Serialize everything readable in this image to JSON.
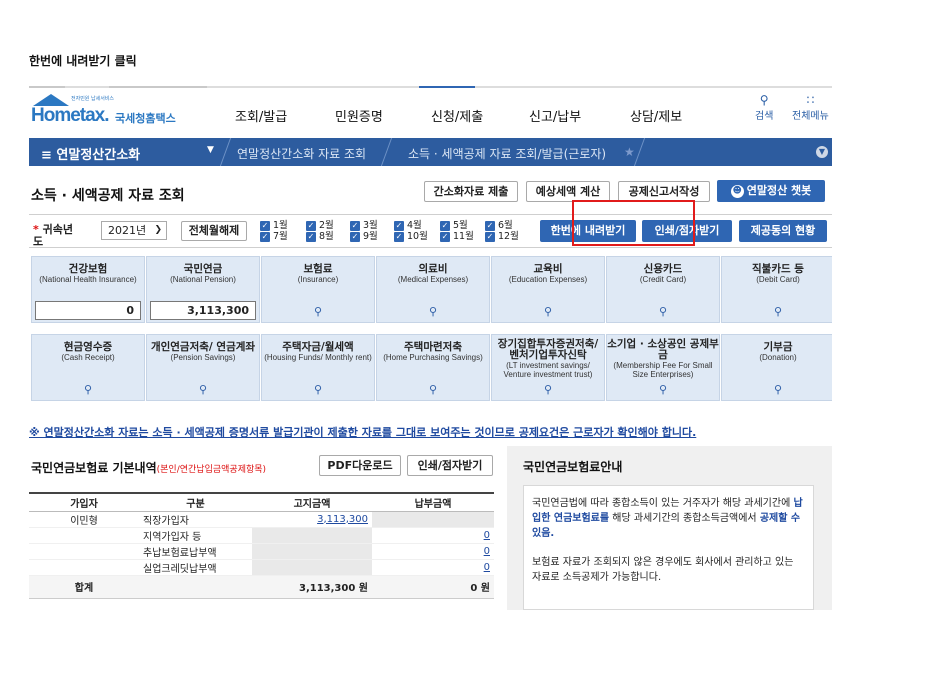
{
  "caption": "한번에 내려받기 클릭",
  "header": {
    "logo_small": "전자민원 납세서비스",
    "logo_word": "Hometax.",
    "logo_kor": "국세청홈택스",
    "menu": [
      "조회/발급",
      "민원증명",
      "신청/제출",
      "신고/납부",
      "상담/제보"
    ],
    "tools": [
      {
        "label": "검색",
        "icon": "search-icon"
      },
      {
        "label": "전체메뉴",
        "icon": "grid-menu-icon"
      }
    ]
  },
  "nav": {
    "menu_label": "≡  연말정산간소화",
    "crumbs": [
      "연말정산간소화 자료 조회",
      "소득 · 세액공제 자료 조회/발급(근로자)"
    ],
    "star": "★"
  },
  "page": {
    "title": "소득 · 세액공제 자료 조회",
    "buttons": {
      "simplified_submit": "간소화자료 제출",
      "expected_tax": "예상세액 계산",
      "report_write": "공제신고서작성",
      "chatbot": "연말정산 챗봇",
      "download_all": "한번에 내려받기",
      "print_braille": "인쇄/점자받기",
      "provider_status": "제공동의 현황",
      "all_months_off": "전체월해제"
    }
  },
  "filter": {
    "label": "귀속년도",
    "year_selected": "2021년",
    "months": [
      "1월",
      "2월",
      "3월",
      "4월",
      "5월",
      "6월",
      "7월",
      "8월",
      "9월",
      "10월",
      "11월",
      "12월"
    ]
  },
  "tiles_row1": [
    {
      "title": "건강보험",
      "eng": "(National Health Insurance)",
      "value": "0"
    },
    {
      "title": "국민연금",
      "eng": "(National Pension)",
      "value": "3,113,300"
    },
    {
      "title": "보험료",
      "eng": "(Insurance)"
    },
    {
      "title": "의료비",
      "eng": "(Medical Expenses)"
    },
    {
      "title": "교육비",
      "eng": "(Education Expenses)"
    },
    {
      "title": "신용카드",
      "eng": "(Credit Card)"
    },
    {
      "title": "직불카드 등",
      "eng": "(Debit Card)"
    }
  ],
  "tiles_row2": [
    {
      "title": "현금영수증",
      "eng": "(Cash Receipt)"
    },
    {
      "title": "개인연금저축/ 연금계좌",
      "eng": "(Pension Savings)"
    },
    {
      "title": "주택자금/월세액",
      "eng": "(Housing Funds/ Monthly rent)"
    },
    {
      "title": "주택마련저축",
      "eng": "(Home Purchasing Savings)"
    },
    {
      "title": "장기집합투자증권저축/ 벤처기업투자신탁",
      "eng": "(LT investment savings/ Venture investment trust)"
    },
    {
      "title": "소기업 · 소상공인 공제부금",
      "eng": "(Membership Fee For Small Size Enterprises)"
    },
    {
      "title": "기부금",
      "eng": "(Donation)"
    }
  ],
  "notice": "※ 연말정산간소화 자료는 소득 · 세액공제 증명서류 발급기관이 제출한 자료를 그대로 보여주는 것이므로 공제요건은 근로자가 확인해야 합니다.",
  "pension_section": {
    "title": "국민연금보험료 기본내역",
    "subtitle": "(본인/연간납입금액공제항목)",
    "pdf_button": "PDF다운로드",
    "print_button": "인쇄/점자받기",
    "columns": [
      "가입자",
      "구분",
      "고지금액",
      "납부금액"
    ],
    "rows": [
      {
        "member": "이민형",
        "type": "직장가입자",
        "notice": "3,113,300",
        "paid": ""
      },
      {
        "member": "",
        "type": "지역가입자 등",
        "notice": "",
        "paid": "0"
      },
      {
        "member": "",
        "type": "추납보험료납부액",
        "notice": "",
        "paid": "0"
      },
      {
        "member": "",
        "type": "실업크레딧납부액",
        "notice": "",
        "paid": "0"
      }
    ],
    "total": {
      "label": "합계",
      "notice": "3,113,300 원",
      "paid": "0 원"
    }
  },
  "guide": {
    "title": "국민연금보험료안내",
    "p1_a": "국민연금법에 따라 종합소득이 있는 거주자가 해당 과세기간에 ",
    "p1_hl1": "납입한 연금보험료를",
    "p1_b": " 해당 과세기간의 종합소득금액에서 ",
    "p1_hl2": "공제할 수 있음.",
    "p2": "보험료 자료가 조회되지 않은 경우에도 회사에서 관리하고 있는 자료로 소득공제가 가능합니다."
  }
}
